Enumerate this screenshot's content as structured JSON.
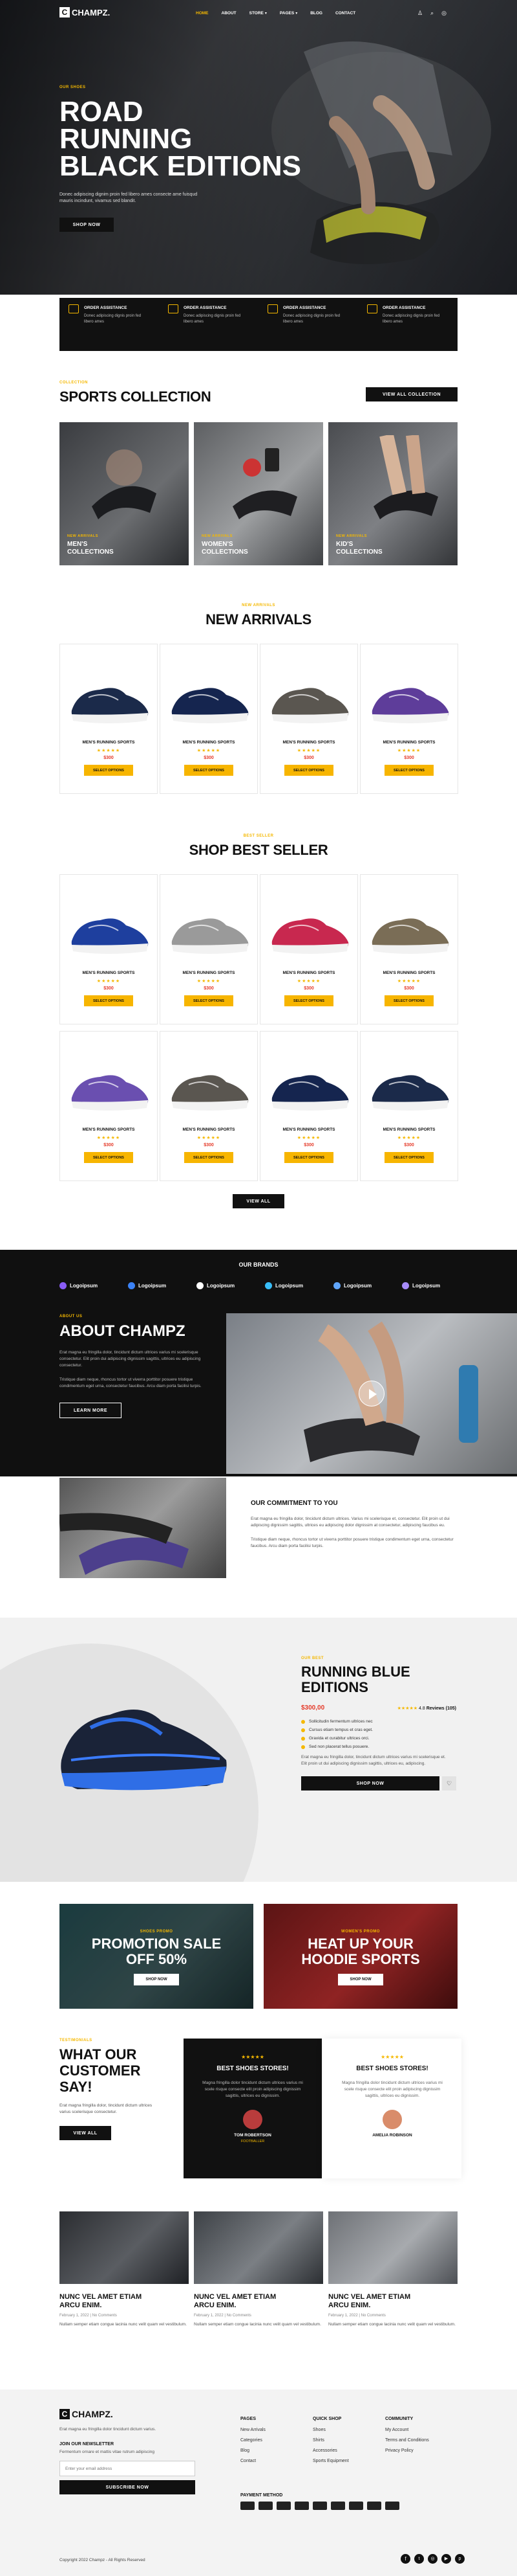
{
  "header": {
    "logo": "CHAMPZ.",
    "nav": [
      "HOME",
      "ABOUT",
      "STORE",
      "PAGES",
      "BLOG",
      "CONTACT"
    ]
  },
  "hero": {
    "kicker": "OUR SHOES",
    "title_lines": [
      "ROAD",
      "RUNNING",
      "BLACK EDITIONS"
    ],
    "desc": "Donec adipiscing dignim proin fed libero ames consecte ame fuisqud mauris incindunt, vivamus sed blandit.",
    "button": "SHOP NOW"
  },
  "features": [
    {
      "title": "ORDER ASSISTANCE",
      "desc": "Donec adipiscing dignis proin fed libero ames"
    },
    {
      "title": "ORDER ASSISTANCE",
      "desc": "Donec adipiscing dignis proin fed libero ames"
    },
    {
      "title": "ORDER ASSISTANCE",
      "desc": "Donec adipiscing dignis proin fed libero ames"
    },
    {
      "title": "ORDER ASSISTANCE",
      "desc": "Donec adipiscing dignis proin fed libero ames"
    }
  ],
  "collection": {
    "kicker": "COLLECTION",
    "title": "SPORTS COLLECTION",
    "button": "VIEW ALL COLLECTION",
    "items": [
      {
        "kicker": "NEW ARRIVALS",
        "name_l1": "MEN'S",
        "name_l2": "COLLECTIONS"
      },
      {
        "kicker": "NEW ARRIVALS",
        "name_l1": "WOMEN'S",
        "name_l2": "COLLECTIONS"
      },
      {
        "kicker": "NEW ARRIVALS",
        "name_l1": "KID'S",
        "name_l2": "COLLECTIONS"
      }
    ]
  },
  "arrivals": {
    "kicker": "NEW ARRIVALS",
    "title": "NEW ARRIVALS",
    "products": [
      {
        "name": "MEN'S RUNNING SPORTS",
        "stars": "★★★★★",
        "price": "$300",
        "button": "SELECT OPTIONS",
        "color": "#1b2a4a"
      },
      {
        "name": "MEN'S RUNNING SPORTS",
        "stars": "★★★★★",
        "price": "$300",
        "button": "SELECT OPTIONS",
        "color": "#15254f"
      },
      {
        "name": "MEN'S RUNNING SPORTS",
        "stars": "★★★★★",
        "price": "$300",
        "button": "SELECT OPTIONS",
        "color": "#5a5650"
      },
      {
        "name": "MEN'S RUNNING SPORTS",
        "stars": "★★★★★",
        "price": "$300",
        "button": "SELECT OPTIONS",
        "color": "#5e3d9a"
      }
    ]
  },
  "bestseller": {
    "kicker": "BEST SELLER",
    "title": "SHOP BEST SELLER",
    "button": "VIEW ALL",
    "products": [
      {
        "name": "MEN'S RUNNING SPORTS",
        "stars": "★★★★★",
        "price": "$300",
        "button": "SELECT OPTIONS",
        "color": "#1e3f9e"
      },
      {
        "name": "MEN'S RUNNING SPORTS",
        "stars": "★★★★★",
        "price": "$300",
        "button": "SELECT OPTIONS",
        "color": "#9a9a9a"
      },
      {
        "name": "MEN'S RUNNING SPORTS",
        "stars": "★★★★★",
        "price": "$300",
        "button": "SELECT OPTIONS",
        "color": "#c8284f"
      },
      {
        "name": "MEN'S RUNNING SPORTS",
        "stars": "★★★★★",
        "price": "$300",
        "button": "SELECT OPTIONS",
        "color": "#7a6d56"
      },
      {
        "name": "MEN'S RUNNING SPORTS",
        "stars": "★★★★★",
        "price": "$300",
        "button": "SELECT OPTIONS",
        "color": "#6a4fb0"
      },
      {
        "name": "MEN'S RUNNING SPORTS",
        "stars": "★★★★★",
        "price": "$300",
        "button": "SELECT OPTIONS",
        "color": "#5a5650"
      },
      {
        "name": "MEN'S RUNNING SPORTS",
        "stars": "★★★★★",
        "price": "$300",
        "button": "SELECT OPTIONS",
        "color": "#15254f"
      },
      {
        "name": "MEN'S RUNNING SPORTS",
        "stars": "★★★★★",
        "price": "$300",
        "button": "SELECT OPTIONS",
        "color": "#1b2a4a"
      }
    ]
  },
  "brands": {
    "title": "OUR BRANDS",
    "items": [
      {
        "name": "Logoipsum",
        "color": "#8a5cf6"
      },
      {
        "name": "Logoipsum",
        "color": "#3b82f6"
      },
      {
        "name": "Logoipsum",
        "color": "#ffffff"
      },
      {
        "name": "Logoipsum",
        "color": "#38bdf8"
      },
      {
        "name": "Logoipsum",
        "color": "#60a5fa"
      },
      {
        "name": "Logoipsum",
        "color": "#a78bfa"
      }
    ]
  },
  "about": {
    "kicker": "ABOUT US",
    "title": "ABOUT CHAMPZ",
    "p1": "Erat magna eu fringilla dolor, tincidunt dictum ultrices varius mi scelerisque consectetur. Elit proin dui adipiscing dignissim sagittis, ultrices eu adipiscing consectetur.",
    "p2": "Tristique diam neque, rhoncus tortor ut viverra porttitor posuere tristique condimentum eget urna, consectetur faucibus. Arcu diam porta facilisi turpis.",
    "button": "LEARN MORE",
    "commit_title": "OUR COMMITMENT TO YOU",
    "commit_p1": "Erat magna eu fringilla dolor, tincidunt dictum ultrices. Varius mi scelerisque et, consectetur. Elit proin ut dui adipiscing dignissim sagittis, ultrices eu adipiscing dolor dignissim at consectetur, adipiscing faucibus eu.",
    "commit_p2": "Tristique diam neque, rhoncus tortor ut viverra porttitor posuere tristique condimentum eget urna, consectetur faucibus. Arcu diam porta facilisi turpis."
  },
  "featured": {
    "kicker": "OUR BEST",
    "title_l1": "RUNNING BLUE",
    "title_l2": "EDITIONS",
    "price": "$300,00",
    "rating": "4.8",
    "reviews": "Reviews (105)",
    "bullets": [
      "Sollicitudin fermentum ultrices nec",
      "Cursus etiam tempus et cras eget.",
      "Gravida et curabitur ultrices orci.",
      "Sed non placerat tellus posuere."
    ],
    "desc": "Erat magna eu fringilla dolor, tincidunt dictum ultrices varius mi scelerisque et. Elit proin ut dui adipiscing dignissim sagittis, ultrices eu, adipiscing.",
    "button": "SHOP NOW"
  },
  "promos": [
    {
      "kicker": "SHOES PROMO",
      "title_l1": "PROMOTION SALE",
      "title_l2": "OFF 50%",
      "button": "SHOP NOW"
    },
    {
      "kicker": "WOMEN'S PROMO",
      "title_l1": "HEAT UP YOUR",
      "title_l2": "HOODIE SPORTS",
      "button": "SHOP NOW"
    }
  ],
  "testimonials": {
    "kicker": "TESTIMONIALS",
    "title_l1": "WHAT OUR",
    "title_l2": "CUSTOMER",
    "title_l3": "SAY!",
    "desc": "Erat magna fringilla dolor, tincidunt dictum ultrices varius scelerisque consectetur.",
    "button": "VIEW ALL",
    "items": [
      {
        "stars": "★★★★★",
        "title": "BEST SHOES STORES!",
        "text": "Magna fringilla dolor tincidunt dictum ultrices varius mi scele risque consecte elit proin adipiscing dignissim sagittis, ultrices eu dignissim.",
        "name": "TOM ROBERTSON",
        "role": "FOOTBALLER"
      },
      {
        "stars": "★★★★★",
        "title": "BEST SHOES STORES!",
        "text": "Magna fringilla dolor tincidunt dictum ultrices varius mi scele risque consecte elit proin adipiscing dignissim sagittis, ultrices eu dignissim.",
        "name": "AMELIA ROBINSON",
        "role": ""
      }
    ]
  },
  "blog": [
    {
      "title_l1": "NUNC VEL AMET ETIAM",
      "title_l2": "ARCU ENIM.",
      "meta": "February 1, 2022 | No Comments",
      "desc": "Nullam semper etiam congue lacinia nunc velit quam vel vestibulum."
    },
    {
      "title_l1": "NUNC VEL AMET ETIAM",
      "title_l2": "ARCU ENIM.",
      "meta": "February 1, 2022 | No Comments",
      "desc": "Nullam semper etiam congue lacinia nunc velit quam vel vestibulum."
    },
    {
      "title_l1": "NUNC VEL AMET ETIAM",
      "title_l2": "ARCU ENIM.",
      "meta": "February 1, 2022 | No Comments",
      "desc": "Nullam semper etiam congue lacinia nunc velit quam vel vestibulum."
    }
  ],
  "footer": {
    "logo": "CHAMPZ.",
    "desc": "Erat magna eu fringilla dolor tincidunt dictum varius.",
    "newsletter_title": "JOIN OUR NEWSLETTER",
    "newsletter_desc": "Fermentum ornare et mattis vitae rutrum adipiscing",
    "email_placeholder": "Enter your email address",
    "subscribe": "SUBSCRIBE NOW",
    "pages_title": "PAGES",
    "pages": [
      "New Arrivals",
      "Categories",
      "Blog",
      "Contact"
    ],
    "quick_title": "QUICK SHOP",
    "quick": [
      "Shoes",
      "Shirts",
      "Accessories",
      "Sports Equipment"
    ],
    "community_title": "COMMUNITY",
    "community": [
      "My Account",
      "Terms and Conditions",
      "Privacy Policy"
    ],
    "payment_title": "PAYMENT METHOD",
    "copyright": "Copyright 2022 Champz - All Rights Reserved"
  }
}
